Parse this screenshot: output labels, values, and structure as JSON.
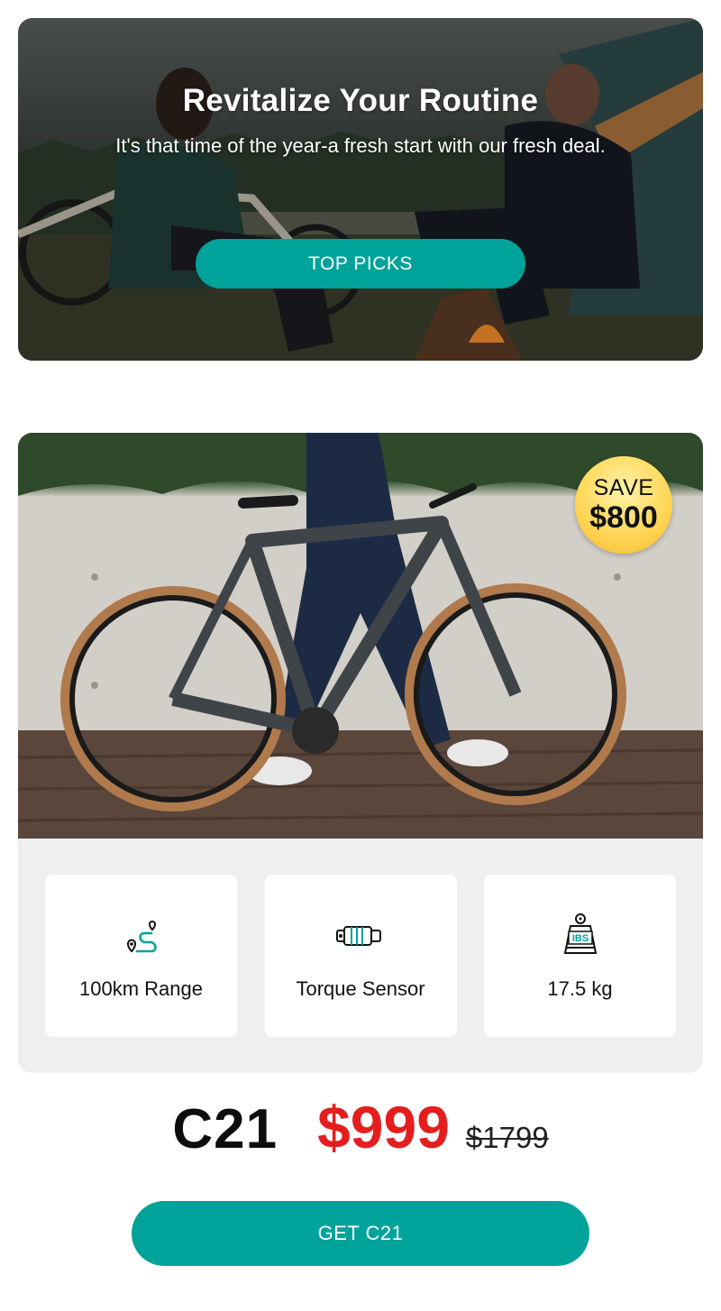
{
  "hero": {
    "title": "Revitalize Your Routine",
    "subtitle": "It's that time of the year-a fresh start with our fresh deal.",
    "button_label": "TOP PICKS"
  },
  "product": {
    "badge": {
      "line1": "SAVE",
      "line2": "$800"
    },
    "features": [
      {
        "icon": "route-pin-icon",
        "label": "100km Range"
      },
      {
        "icon": "torque-sensor-icon",
        "label": "Torque Sensor"
      },
      {
        "icon": "weight-icon",
        "label": "17.5 kg",
        "icon_text": "IBS"
      }
    ],
    "model": "C21",
    "sale_price": "$999",
    "original_price": "$1799",
    "cta_label": "GET C21"
  },
  "colors": {
    "accent": "#00a39a",
    "sale_red": "#e41e1e",
    "badge_gold": "#ffd85a",
    "card_bg": "#efefef"
  }
}
